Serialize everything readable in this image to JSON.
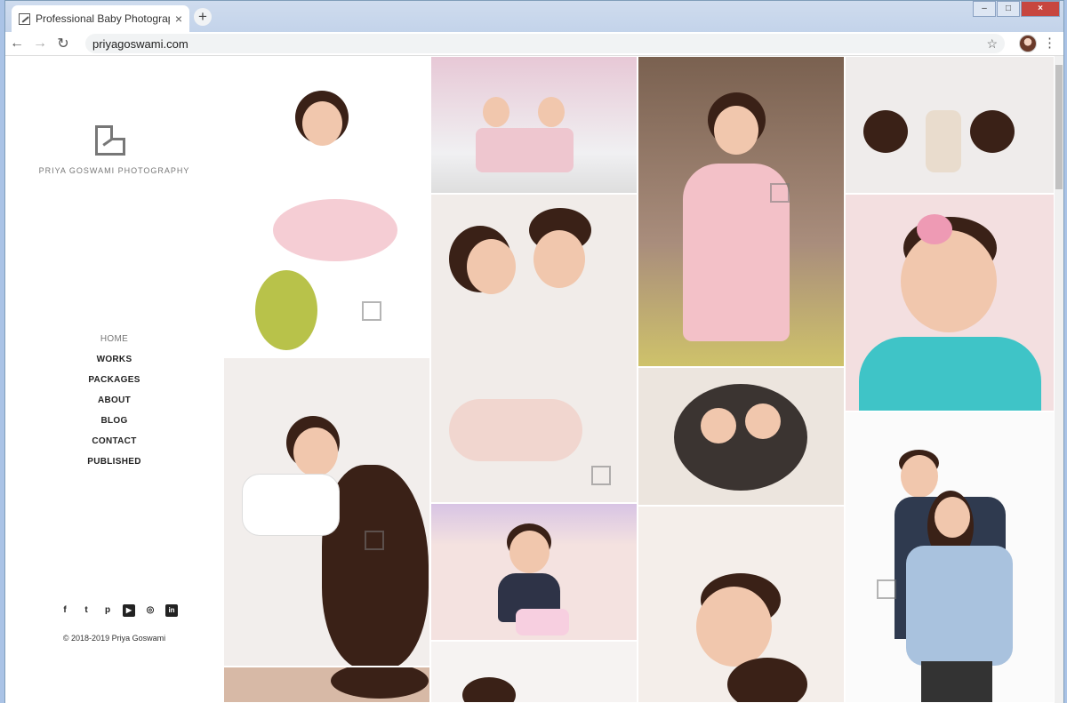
{
  "browser": {
    "tab_title": "Professional Baby Photographer",
    "tab_close": "×",
    "new_tab": "+",
    "address": "priyagoswami.com",
    "window_controls": [
      "–",
      "□",
      "×"
    ]
  },
  "sidebar": {
    "brand": "PRIYA GOSWAMI PHOTOGRAPHY",
    "nav": [
      "HOME",
      "WORKS",
      "PACKAGES",
      "ABOUT",
      "BLOG",
      "CONTACT",
      "PUBLISHED"
    ],
    "social": [
      "f",
      "t",
      "p",
      "▶",
      "◎",
      "in"
    ],
    "copyright": "© 2018-2019 Priya Goswami"
  },
  "gallery": [
    {
      "name": "toddler-pink-tutu-flowers",
      "bg": "#f4efed"
    },
    {
      "name": "twins-party-hats-eiffel",
      "bg": "#e8cfd6"
    },
    {
      "name": "girl-pink-dress-pinwheel",
      "bg": "#8a6f5c"
    },
    {
      "name": "mothers-with-newborn-top",
      "bg": "#e9e6e6"
    },
    {
      "name": "family-with-newborn",
      "bg": "#efe7e2"
    },
    {
      "name": "newborn-twins-nest",
      "bg": "#e6dfd8"
    },
    {
      "name": "baby-teal-shirt",
      "bg": "#f0d8da"
    },
    {
      "name": "mother-kissing-toddler",
      "bg": "#f1ece9"
    },
    {
      "name": "cake-smash-first-birthday",
      "bg": "#f3e2e1"
    },
    {
      "name": "toddler-lying-closeup",
      "bg": "#f4eeea"
    },
    {
      "name": "maternity-couple",
      "bg": "#fbfbfb"
    }
  ]
}
